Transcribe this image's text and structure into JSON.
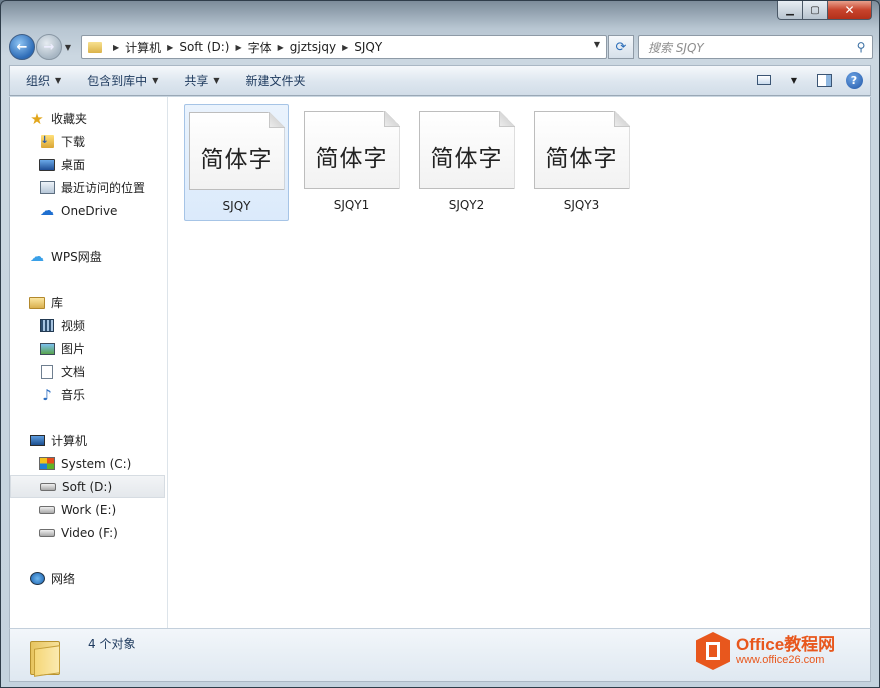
{
  "window": {
    "caption": {
      "minimize": "▁",
      "maximize": "▢",
      "close": "✕"
    }
  },
  "address": {
    "breadcrumbs": [
      "计算机",
      "Soft (D:)",
      "字体",
      "gjztsjqy",
      "SJQY"
    ]
  },
  "search": {
    "placeholder": "搜索 SJQY"
  },
  "toolbar": {
    "organize": "组织",
    "include_in_library": "包含到库中",
    "share": "共享",
    "new_folder": "新建文件夹"
  },
  "sidebar": {
    "favorites": {
      "label": "收藏夹",
      "items": [
        {
          "label": "下载",
          "icon": "downloads-icon"
        },
        {
          "label": "桌面",
          "icon": "desktop-icon"
        },
        {
          "label": "最近访问的位置",
          "icon": "recent-places-icon"
        },
        {
          "label": "OneDrive",
          "icon": "onedrive-icon"
        }
      ]
    },
    "wps": {
      "label": "WPS网盘"
    },
    "libraries": {
      "label": "库",
      "items": [
        {
          "label": "视频",
          "icon": "videos-icon"
        },
        {
          "label": "图片",
          "icon": "pictures-icon"
        },
        {
          "label": "文档",
          "icon": "documents-icon"
        },
        {
          "label": "音乐",
          "icon": "music-icon"
        }
      ]
    },
    "computer": {
      "label": "计算机",
      "items": [
        {
          "label": "System (C:)",
          "icon": "system-drive-icon"
        },
        {
          "label": "Soft (D:)",
          "icon": "drive-icon",
          "selected": true
        },
        {
          "label": "Work (E:)",
          "icon": "drive-icon"
        },
        {
          "label": "Video (F:)",
          "icon": "drive-icon"
        }
      ]
    },
    "network": {
      "label": "网络"
    }
  },
  "files": [
    {
      "name": "SJQY",
      "preview": "简体字",
      "selected": true
    },
    {
      "name": "SJQY1",
      "preview": "简体字"
    },
    {
      "name": "SJQY2",
      "preview": "简体字"
    },
    {
      "name": "SJQY3",
      "preview": "简体字"
    }
  ],
  "details": {
    "count": "4 个对象"
  },
  "watermark": {
    "brand": "Office",
    "brand_cn": "教程网",
    "url": "www.office26.com",
    "color": "#e8571d"
  }
}
